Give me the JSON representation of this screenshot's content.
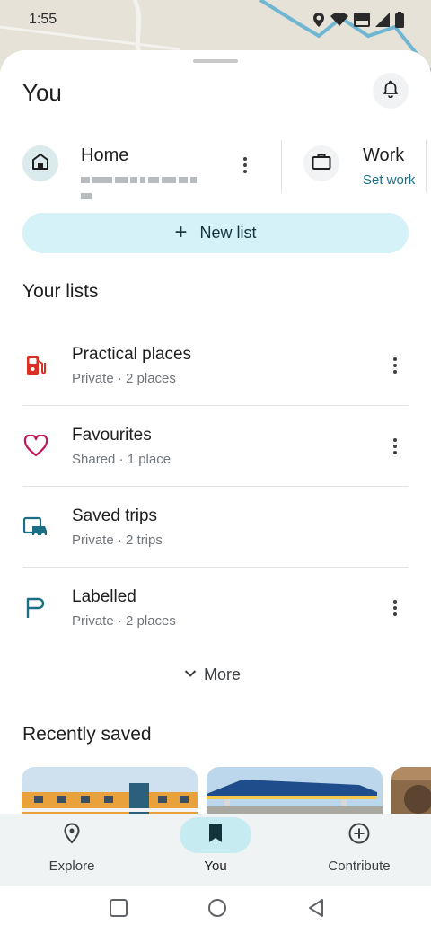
{
  "status_bar": {
    "time": "1:55",
    "icons": [
      "location-icon",
      "wifi-icon",
      "volte-icon",
      "signal-icon",
      "battery-icon"
    ]
  },
  "sheet": {
    "title": "You"
  },
  "home": {
    "label": "Home"
  },
  "work": {
    "label": "Work",
    "sub": "Set work"
  },
  "new_list": {
    "plus": "+",
    "label": "New list"
  },
  "your_lists": {
    "title": "Your lists",
    "items": [
      {
        "title": "Practical places",
        "sub": "Private · 2 places",
        "icon": "fuel-icon",
        "color": "#d93025"
      },
      {
        "title": "Favourites",
        "sub": "Shared · 1 place",
        "icon": "heart-icon",
        "color": "#c2185b"
      },
      {
        "title": "Saved trips",
        "sub": "Private · 2 trips",
        "icon": "trips-icon",
        "color": "#1b6e83"
      },
      {
        "title": "Labelled",
        "sub": "Private · 2 places",
        "icon": "flag-icon",
        "color": "#1b6e83"
      }
    ],
    "more_label": "More"
  },
  "recently_saved": {
    "title": "Recently saved"
  },
  "bottom_nav": {
    "items": [
      {
        "label": "Explore",
        "icon": "location-pin-icon"
      },
      {
        "label": "You",
        "icon": "bookmark-icon",
        "active": true
      },
      {
        "label": "Contribute",
        "icon": "add-circle-icon"
      }
    ]
  },
  "colors": {
    "accent": "#1b6e83",
    "new_list_bg": "#d4f2f7",
    "nav_active_bg": "#c6ecf2",
    "nav_bg": "#f0f3f4"
  }
}
